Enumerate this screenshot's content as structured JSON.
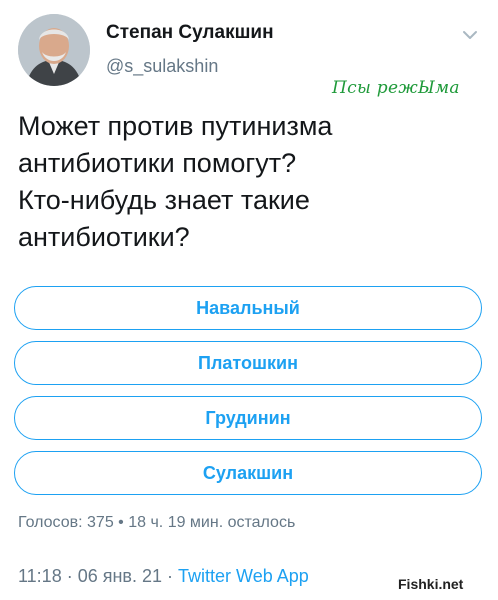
{
  "author": {
    "name": "Степан Сулакшин",
    "handle": "@s_sulakshin"
  },
  "watermark_text": "Псы режЫма",
  "tweet": {
    "lines": [
      "Может против путинизма",
      "антибиотики помогут?",
      "Кто-нибудь знает такие",
      "антибиотики?"
    ]
  },
  "poll": {
    "options": [
      "Навальный",
      "Платошкин",
      "Грудинин",
      "Сулакшин"
    ],
    "votes_label": "Голосов: 375",
    "separator": " • ",
    "time_left": "18 ч. 19 мин. осталось"
  },
  "footer": {
    "time": "11:18",
    "dot": " · ",
    "date": "06 янв. 21",
    "app": "Twitter Web App"
  },
  "site_watermark": "Fishki.net",
  "colors": {
    "accent": "#1da1f2",
    "muted": "#657786",
    "text": "#14171a",
    "watermark_green": "#1f9a3a"
  },
  "icons": [
    "avatar",
    "chevron-down-icon"
  ]
}
